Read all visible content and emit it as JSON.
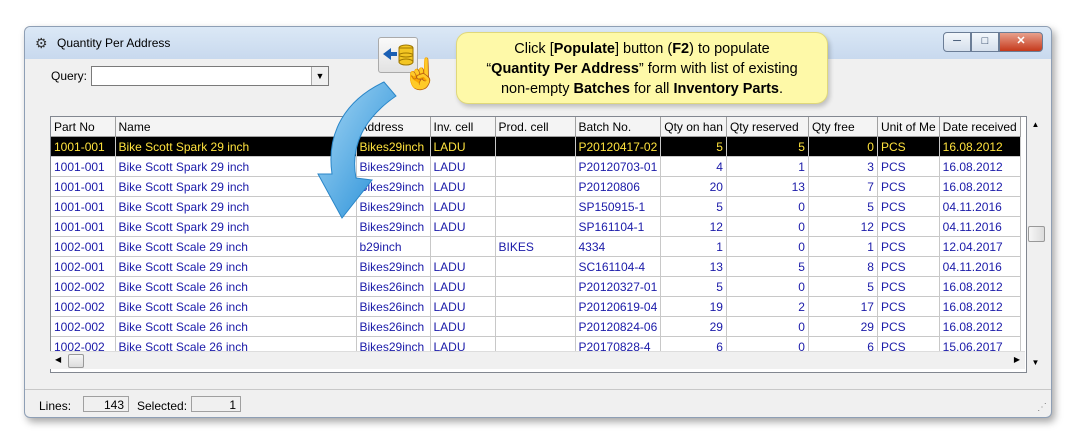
{
  "window": {
    "title": "Quantity Per Address",
    "buttons": [
      "minimize",
      "restore",
      "close"
    ]
  },
  "query": {
    "label": "Query:",
    "value": ""
  },
  "callout": {
    "line1_a": "Click [",
    "line1_b": "Populate",
    "line1_c": "] button (",
    "line1_d": "F2",
    "line1_e": ") to populate",
    "line2_a": "“",
    "line2_b": "Quantity Per Address",
    "line2_c": "” form with list of existing",
    "line3_a": "non-empty ",
    "line3_b": "Batches",
    "line3_c": " for all ",
    "line3_d": "Inventory Parts",
    "line3_e": "."
  },
  "grid": {
    "columns": [
      "Part No",
      "Name",
      "Address",
      "Inv. cell",
      "Prod. cell",
      "Batch No.",
      "Qty on han",
      "Qty reserved",
      "Qty free",
      "Unit of Me",
      "Date received"
    ],
    "rows": [
      [
        "1001-001",
        "Bike Scott Spark 29 inch",
        "Bikes29inch",
        "LADU",
        "",
        "P20120417-02",
        "5",
        "5",
        "0",
        "PCS",
        "16.08.2012"
      ],
      [
        "1001-001",
        "Bike Scott Spark 29 inch",
        "Bikes29inch",
        "LADU",
        "",
        "P20120703-01",
        "4",
        "1",
        "3",
        "PCS",
        "16.08.2012"
      ],
      [
        "1001-001",
        "Bike Scott Spark 29 inch",
        "Bikes29inch",
        "LADU",
        "",
        "P20120806",
        "20",
        "13",
        "7",
        "PCS",
        "16.08.2012"
      ],
      [
        "1001-001",
        "Bike Scott Spark 29 inch",
        "Bikes29inch",
        "LADU",
        "",
        "SP150915-1",
        "5",
        "0",
        "5",
        "PCS",
        "04.11.2016"
      ],
      [
        "1001-001",
        "Bike Scott Spark 29 inch",
        "Bikes29inch",
        "LADU",
        "",
        "SP161104-1",
        "12",
        "0",
        "12",
        "PCS",
        "04.11.2016"
      ],
      [
        "1002-001",
        "Bike Scott Scale 29 inch",
        "b29inch",
        "",
        "BIKES",
        "4334",
        "1",
        "0",
        "1",
        "PCS",
        "12.04.2017"
      ],
      [
        "1002-001",
        "Bike Scott Scale 29 inch",
        "Bikes29inch",
        "LADU",
        "",
        "SC161104-4",
        "13",
        "5",
        "8",
        "PCS",
        "04.11.2016"
      ],
      [
        "1002-002",
        "Bike Scott Scale 26 inch",
        "Bikes26inch",
        "LADU",
        "",
        "P20120327-01",
        "5",
        "0",
        "5",
        "PCS",
        "16.08.2012"
      ],
      [
        "1002-002",
        "Bike Scott Scale 26 inch",
        "Bikes26inch",
        "LADU",
        "",
        "P20120619-04",
        "19",
        "2",
        "17",
        "PCS",
        "16.08.2012"
      ],
      [
        "1002-002",
        "Bike Scott Scale 26 inch",
        "Bikes26inch",
        "LADU",
        "",
        "P20120824-06",
        "29",
        "0",
        "29",
        "PCS",
        "16.08.2012"
      ],
      [
        "1002-002",
        "Bike Scott Scale 26 inch",
        "Bikes29inch",
        "LADU",
        "",
        "P20170828-4",
        "6",
        "0",
        "6",
        "PCS",
        "15.06.2017"
      ]
    ],
    "selected_row": 0
  },
  "status": {
    "lines_label": "Lines:",
    "lines_value": "143",
    "selected_label": "Selected:",
    "selected_value": "1"
  },
  "colors": {
    "selected_bg": "#000000",
    "selected_fg": "#ffe33d",
    "row_fg": "#1a1aa8",
    "callout_bg": "#fef9a8",
    "arrow": "#3aa0e0"
  },
  "icons": {
    "app": "gear-icon",
    "populate": "populate-db-icon",
    "hand": "hand-pointer-icon",
    "arrow": "curved-arrow-icon"
  }
}
